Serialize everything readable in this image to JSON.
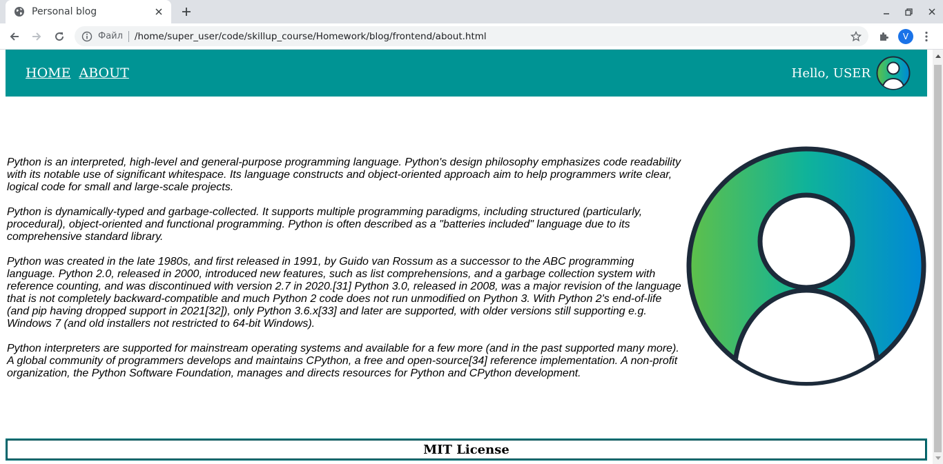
{
  "browser": {
    "tab_title": "Personal blog",
    "scheme_label": "Файл",
    "url": "/home/super_user/code/skillup_course/Homework/blog/frontend/about.html",
    "profile_initial": "V"
  },
  "icons": {
    "favicon": "globe-icon",
    "tab_close": "close-icon",
    "new_tab": "plus-icon",
    "back": "arrow-left-icon",
    "forward": "arrow-right-icon",
    "reload": "reload-icon",
    "site_info": "info-icon",
    "bookmark": "star-icon",
    "extensions": "puzzle-icon",
    "menu": "kebab-menu-icon"
  },
  "header": {
    "nav": [
      {
        "label": "HOME"
      },
      {
        "label": "ABOUT"
      }
    ],
    "greeting": "Hello, USER"
  },
  "content": {
    "paragraphs": [
      "Python is an interpreted, high-level and general-purpose programming language. Python's design philosophy emphasizes code readability with its notable use of significant whitespace. Its language constructs and object-oriented approach aim to help programmers write clear, logical code for small and large-scale projects.",
      "Python is dynamically-typed and garbage-collected. It supports multiple programming paradigms, including structured (particularly, procedural), object-oriented and functional programming. Python is often described as a \"batteries included\" language due to its comprehensive standard library.",
      "Python was created in the late 1980s, and first released in 1991, by Guido van Rossum as a successor to the ABC programming language. Python 2.0, released in 2000, introduced new features, such as list comprehensions, and a garbage collection system with reference counting, and was discontinued with version 2.7 in 2020.[31] Python 3.0, released in 2008, was a major revision of the language that is not completely backward-compatible and much Python 2 code does not run unmodified on Python 3. With Python 2's end-of-life (and pip having dropped support in 2021[32]), only Python 3.6.x[33] and later are supported, with older versions still supporting e.g. Windows 7 (and old installers not restricted to 64-bit Windows).",
      "Python interpreters are supported for mainstream operating systems and available for a few more (and in the past supported many more). A global community of programmers develops and maintains CPython, a free and open-source[34] reference implementation. A non-profit organization, the Python Software Foundation, manages and directs resources for Python and CPython development."
    ]
  },
  "footer": {
    "license": "MIT License"
  },
  "colors": {
    "header_bg": "#009494",
    "footer_border": "#006e73",
    "avatar_gradient_start": "#5fc04a",
    "avatar_gradient_mid": "#0fb39a",
    "avatar_gradient_end": "#0088d6",
    "avatar_outline": "#1c2a3a"
  }
}
